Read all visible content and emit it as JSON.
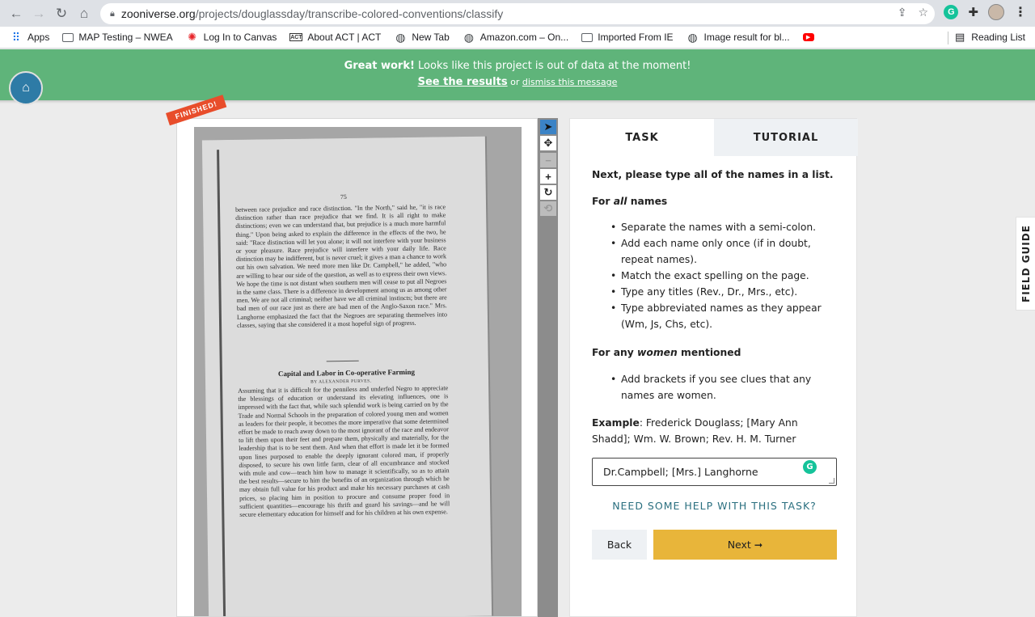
{
  "browser": {
    "url_host": "zooniverse.org",
    "url_path": "/projects/douglassday/transcribe-colored-conventions/classify",
    "bookmarks": [
      {
        "label": "Apps",
        "icon": "apps-grid-icon"
      },
      {
        "label": "MAP Testing – NWEA",
        "icon": "folder-icon"
      },
      {
        "label": "Log In to Canvas",
        "icon": "canvas-icon"
      },
      {
        "label": "About ACT | ACT",
        "icon": "act-icon"
      },
      {
        "label": "New Tab",
        "icon": "globe-icon"
      },
      {
        "label": "Amazon.com – On...",
        "icon": "globe-icon"
      },
      {
        "label": "Imported From IE",
        "icon": "folder-icon"
      },
      {
        "label": "Image result for bl...",
        "icon": "globe-icon"
      },
      {
        "label": "",
        "icon": "youtube-icon"
      }
    ],
    "reading_list": "Reading List"
  },
  "banner": {
    "great_work": "Great work!",
    "message": " Looks like this project is out of data at the moment!",
    "see_results": "See the results",
    "or": " or ",
    "dismiss": "dismiss this message",
    "color": "#5fb47a"
  },
  "viewer": {
    "finished_label": "FINISHED!",
    "page_number": "75",
    "paragraph1": "between race prejudice and race distinction. \"In the North,\" said he, \"it is race distinction rather than race prejudice that we find. It is all right to make distinctions; even we can understand that, but prejudice is a much more harmful thing.\" Upon being asked to explain the difference in the effects of the two, he said: \"Race distinction will let you alone; it will not interfere with your business or your pleasure. Race prejudice will interfere with your daily life. Race distinction may be indifferent, but is never cruel; it gives a man a chance to work out his own salvation. We need more men like Dr. Campbell,\" he added, \"who are willing to hear our side of the question, as well as to express their own views. We hope the time is not distant when southern men will cease to put all Negroes in the same class. There is a difference in development among us as among other men. We are not all criminal; neither have we all criminal instincts; but there are bad men of our race just as there are bad men of the Anglo-Saxon race.\" Mrs. Langhorne emphasized the fact that the Negroes are separating themselves into classes, saying that she considered it a most hopeful sign of progress.",
    "section_title": "Capital and Labor in Co-operative Farming",
    "section_author": "BY ALEXANDER PURVES.",
    "paragraph2": "Assuming that it is difficult for the penniless and underfed Negro to appreciate the blessings of education or understand its elevating influences, one is impressed with the fact that, while such splendid work is being carried on by the Trade and Normal Schools in the preparation of colored young men and women as leaders for their people, it becomes the more imperative that some determined effort be made to reach away down to the most ignorant of the race and endeavor to lift them upon their feet and prepare them, physically and materially, for the leadership that is to be sent them. And when that effort is made let it be formed upon lines purposed to enable the deeply ignorant colored man, if properly disposed, to secure his own little farm, clear of all encumbrance and stocked with mule and cow—teach him how to manage it scientifically, so as to attain the best results—secure to him the benefits of an organization through which he may obtain full value for his product and make his necessary purchases at cash prices, so placing him in position to procure and consume proper food in sufficient quantities—encourage his thrift and guard his savings—and he will secure elementary education for himself and for his children at his own expense."
  },
  "tools": [
    {
      "name": "pointer-tool",
      "icon": "▲",
      "state": "active"
    },
    {
      "name": "move-tool",
      "icon": "✥",
      "state": "normal"
    },
    {
      "name": "zoom-out-tool",
      "icon": "−",
      "state": "disabled"
    },
    {
      "name": "zoom-in-tool",
      "icon": "+",
      "state": "normal"
    },
    {
      "name": "rotate-tool",
      "icon": "↻",
      "state": "normal"
    },
    {
      "name": "reset-tool",
      "icon": "⟲",
      "state": "disabled"
    }
  ],
  "task": {
    "tab_task": "TASK",
    "tab_tutorial": "TUTORIAL",
    "instruction": "Next, please type all of the names in a list.",
    "for_all_prefix": "For ",
    "for_all_em": "all",
    "for_all_suffix": " names",
    "all_bullets": [
      "Separate the names with a semi-colon.",
      "Add each name only once (if in doubt, repeat names).",
      "Match the exact spelling on the page.",
      "Type any titles (Rev., Dr., Mrs., etc).",
      "Type abbreviated names as they appear (Wm, Js, Chs, etc)."
    ],
    "for_women_prefix": "For any ",
    "for_women_em": "women",
    "for_women_suffix": " mentioned",
    "women_bullets": [
      "Add brackets if you see clues that any names are women."
    ],
    "example_label": "Example",
    "example_text": ": Frederick Douglass; [Mary Ann Shadd]; Wm. W. Brown; Rev. H. M. Turner",
    "answer_value": "Dr.Campbell; [Mrs.] Langhorne",
    "help_link": "NEED SOME HELP WITH THIS TASK?",
    "back_label": "Back",
    "next_label": "Next ➞",
    "next_color": "#e8b53a"
  },
  "field_guide": "FIELD GUIDE"
}
